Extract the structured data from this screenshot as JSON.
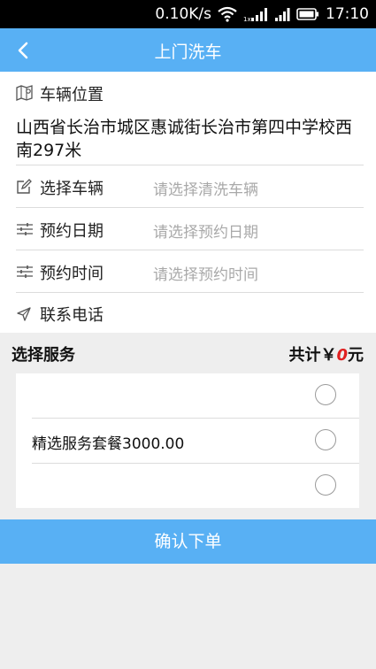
{
  "status_bar": {
    "speed": "0.10K/s",
    "network_type": "1x",
    "time": "17:10"
  },
  "header": {
    "title": "上门洗车",
    "back_icon": "chevron-left-icon"
  },
  "location": {
    "label": "车辆位置",
    "icon": "map-pin-icon",
    "address": "山西省长治市城区惠诚街长治市第四中学校西南297米"
  },
  "fields": [
    {
      "label": "选择车辆",
      "placeholder": "请选择清洗车辆",
      "icon": "edit-icon"
    },
    {
      "label": "预约日期",
      "placeholder": "请选择预约日期",
      "icon": "sliders-icon"
    },
    {
      "label": "预约时间",
      "placeholder": "请选择预约时间",
      "icon": "sliders-icon"
    },
    {
      "label": "联系电话",
      "placeholder": "",
      "icon": "send-icon"
    }
  ],
  "services": {
    "title": "选择服务",
    "total_prefix": "共计￥",
    "total_amount": "0",
    "total_suffix": "元",
    "items": [
      {
        "name": "",
        "selected": false
      },
      {
        "name": "精选服务套餐3000.00",
        "selected": false
      },
      {
        "name": "",
        "selected": false
      }
    ]
  },
  "confirm_label": "确认下单",
  "colors": {
    "primary": "#58b0f4",
    "accent": "#e02020",
    "background": "#eeeeee"
  }
}
